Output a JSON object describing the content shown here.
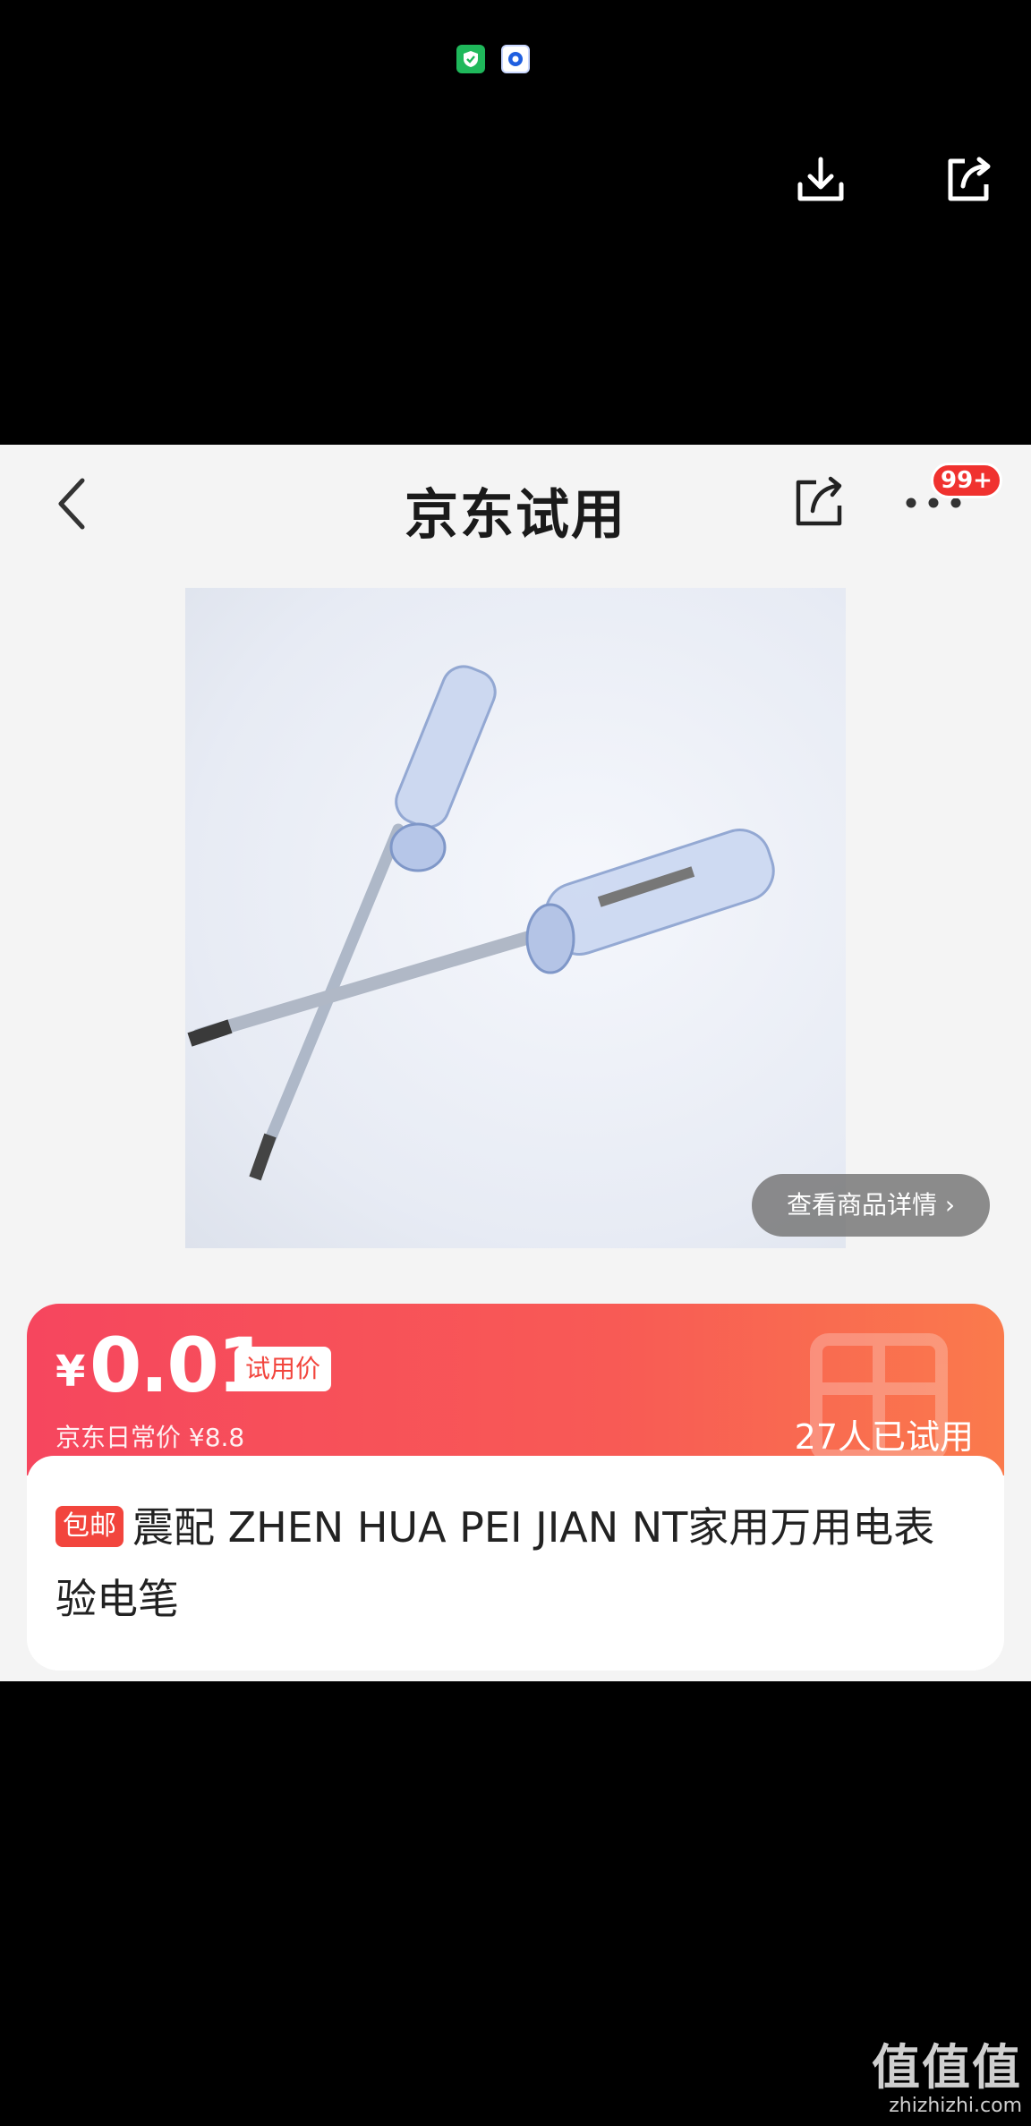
{
  "status": {
    "icons": [
      "shield-check-icon",
      "bubble-icon"
    ]
  },
  "viewer": {
    "actions": [
      "download-icon",
      "share-icon"
    ]
  },
  "nav": {
    "title": "京东试用",
    "badge": "99+"
  },
  "photo": {
    "detail_label": "查看商品详情",
    "detail_chevron": "›"
  },
  "price": {
    "currency": "¥",
    "amount": "0.01",
    "tag": "试用价",
    "daily_label": "京东日常价 ¥8.8",
    "tried": "27人已试用"
  },
  "product": {
    "ship_tag": "包邮",
    "title": "震配 ZHEN HUA PEI JIAN NT家用万用电表 验电笔"
  },
  "watermark": {
    "logo": "值值值",
    "url": "zhizhizhi.com"
  },
  "colors": {
    "accent": "#f2453d",
    "band_start": "#f6465e",
    "band_end": "#fa7a4c",
    "badge": "#f0322f"
  }
}
